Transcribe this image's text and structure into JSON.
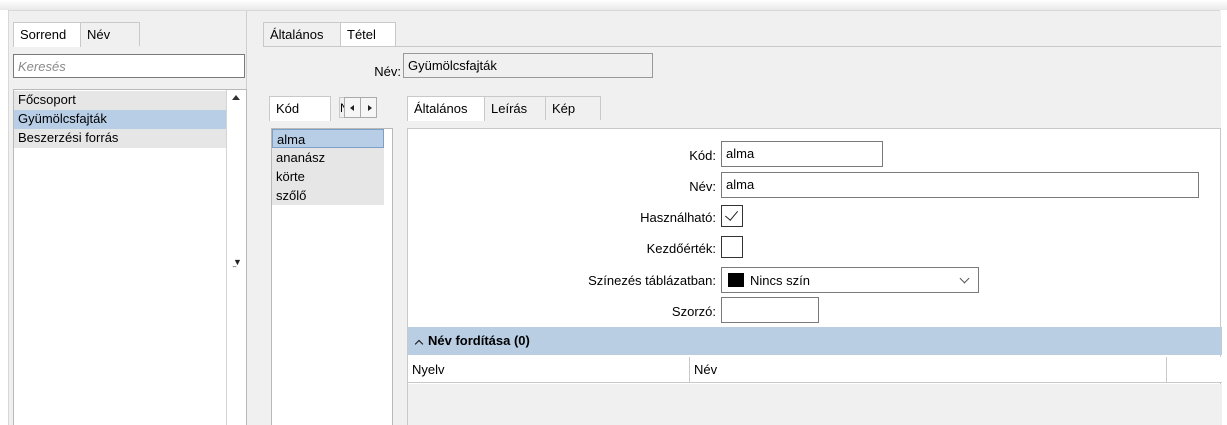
{
  "left": {
    "tabs": [
      {
        "label": "Sorrend",
        "active": true
      },
      {
        "label": "Név",
        "active": false
      }
    ],
    "search_placeholder": "Keresés",
    "items": [
      {
        "label": "Főcsoport",
        "selected": false
      },
      {
        "label": "Gyümölcsfajták",
        "selected": true
      },
      {
        "label": "Beszerzési forrás",
        "selected": false
      }
    ]
  },
  "main": {
    "tabs": [
      {
        "label": "Általános",
        "active": false
      },
      {
        "label": "Tétel",
        "active": true
      }
    ],
    "name_label": "Név:",
    "name_value": "Gyümölcsfajták",
    "code_tabs": [
      {
        "label": "Kód",
        "active": true
      }
    ],
    "code_tab_cut": "N",
    "code_items": [
      {
        "label": "alma",
        "selected": true
      },
      {
        "label": "ananász",
        "selected": false
      },
      {
        "label": "körte",
        "selected": false
      },
      {
        "label": "szőlő",
        "selected": false
      }
    ],
    "detail_tabs": [
      {
        "label": "Általános",
        "active": true
      },
      {
        "label": "Leírás",
        "active": false
      },
      {
        "label": "Kép",
        "active": false
      }
    ]
  },
  "form": {
    "code_label": "Kód:",
    "code_value": "alma",
    "name_label": "Név:",
    "name_value": "alma",
    "usable_label": "Használható:",
    "usable_checked": true,
    "default_label": "Kezdőérték:",
    "default_checked": false,
    "color_label": "Színezés táblázatban:",
    "color_value": "Nincs szín",
    "color_swatch": "#000000",
    "multiplier_label": "Szorzó:",
    "multiplier_value": ""
  },
  "translation": {
    "header": "Név fordítása (0)",
    "columns": [
      "Nyelv",
      "Név"
    ]
  },
  "colors": {
    "selection": "#b8cde6",
    "section_header": "#b9cde3",
    "panel_bg": "#f0f0f0"
  }
}
